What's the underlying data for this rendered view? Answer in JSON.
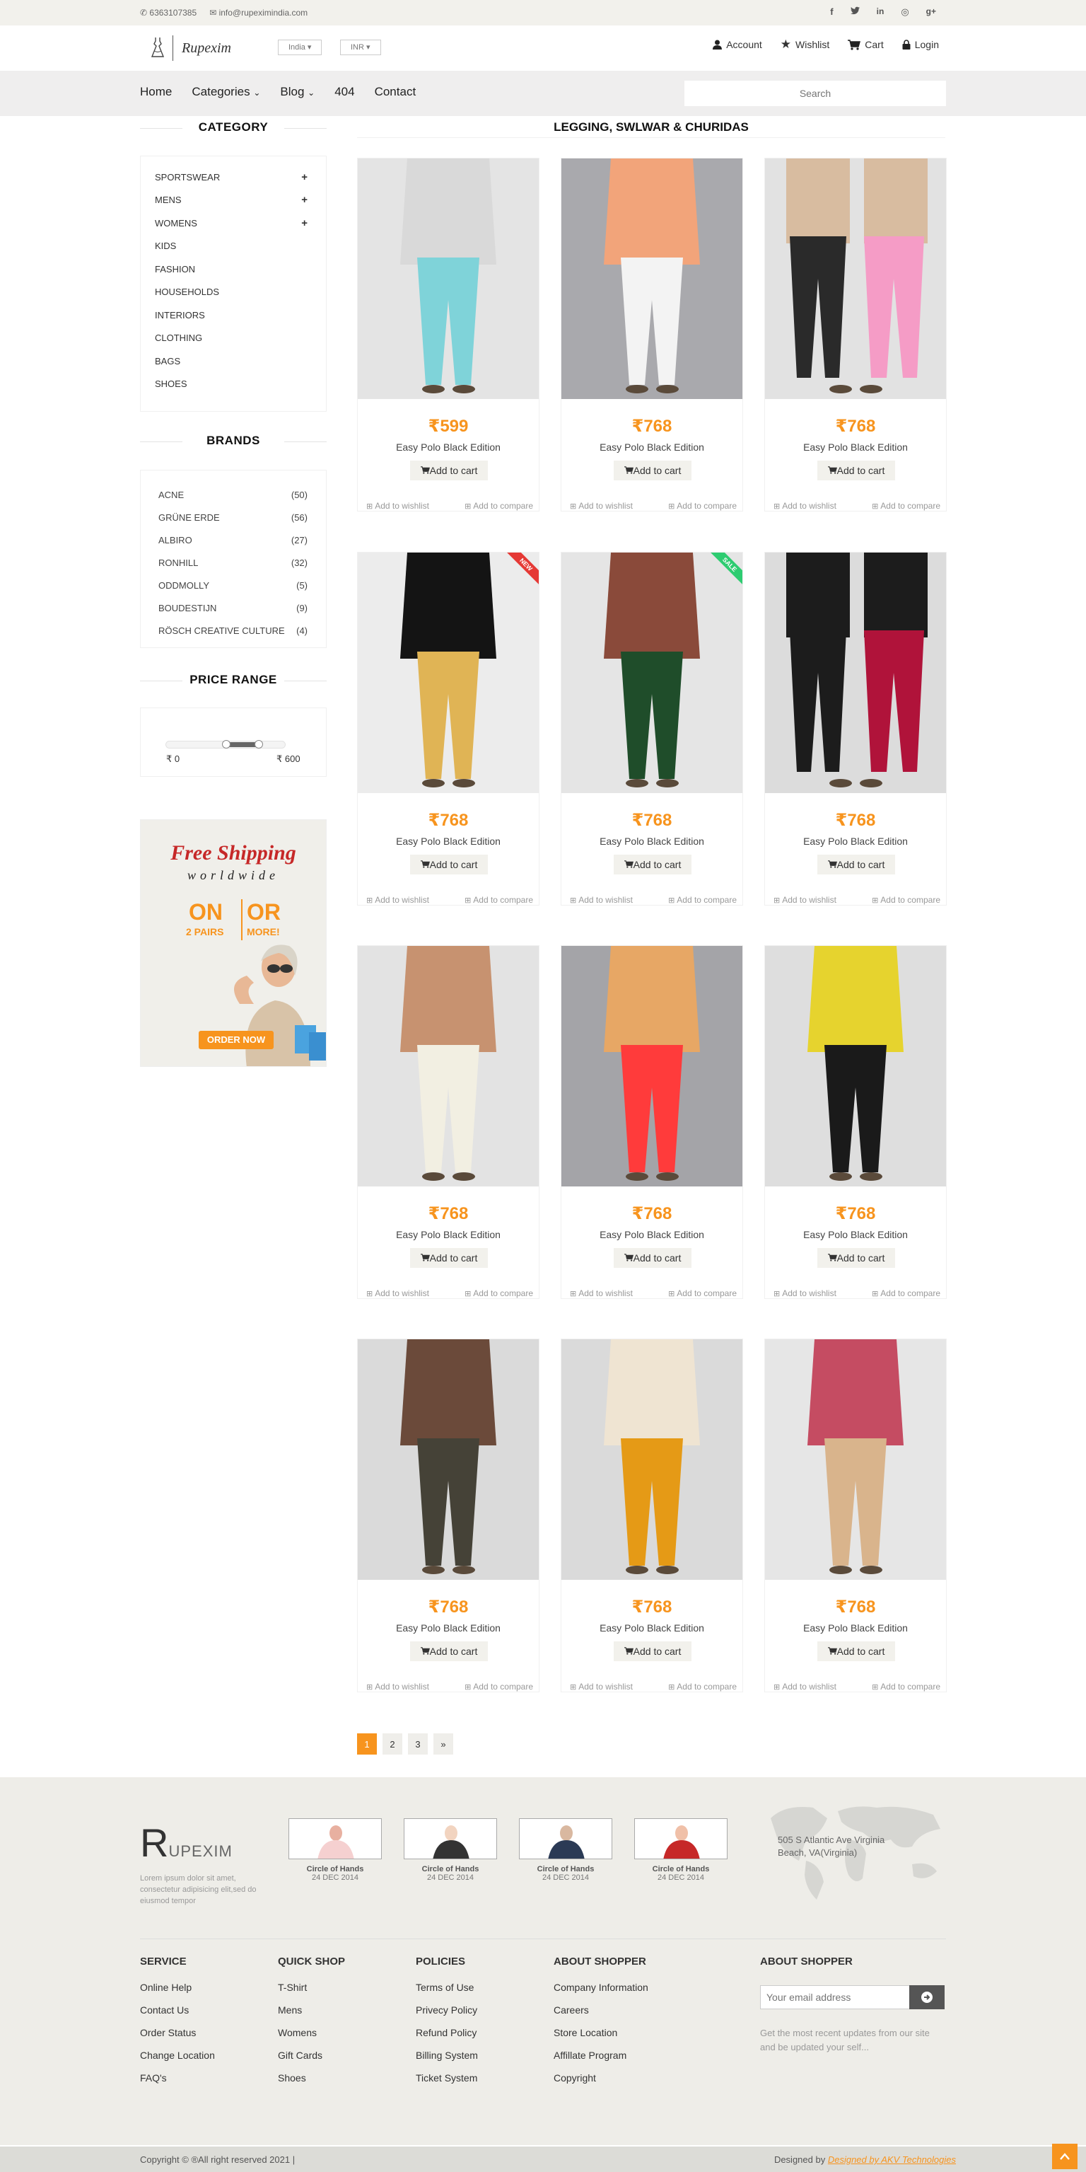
{
  "topbar": {
    "phone": "6363107385",
    "email": "info@rupeximindia.com",
    "social": [
      "facebook-icon",
      "twitter-icon",
      "linkedin-icon",
      "dribbble-icon",
      "google-plus-icon"
    ]
  },
  "header": {
    "brand": "Rupexim",
    "country": "India",
    "currency": "INR",
    "links": {
      "account": "Account",
      "wishlist": "Wishlist",
      "cart": "Cart",
      "login": "Login"
    }
  },
  "nav": {
    "home": "Home",
    "categories": "Categories",
    "blog": "Blog",
    "page404": "404",
    "contact": "Contact",
    "search_placeholder": "Search"
  },
  "sidebar": {
    "category_title": "CATEGORY",
    "categories": [
      {
        "label": "SPORTSWEAR",
        "expand": "+"
      },
      {
        "label": "MENS",
        "expand": "+"
      },
      {
        "label": "WOMENS",
        "expand": "+"
      },
      {
        "label": "KIDS",
        "expand": ""
      },
      {
        "label": "FASHION",
        "expand": ""
      },
      {
        "label": "HOUSEHOLDS",
        "expand": ""
      },
      {
        "label": "INTERIORS",
        "expand": ""
      },
      {
        "label": "CLOTHING",
        "expand": ""
      },
      {
        "label": "BAGS",
        "expand": ""
      },
      {
        "label": "SHOES",
        "expand": ""
      }
    ],
    "brands_title": "BRANDS",
    "brands": [
      {
        "label": "ACNE",
        "count": "(50)"
      },
      {
        "label": "GRÜNE ERDE",
        "count": "(56)"
      },
      {
        "label": "ALBIRO",
        "count": "(27)"
      },
      {
        "label": "RONHILL",
        "count": "(32)"
      },
      {
        "label": "ODDMOLLY",
        "count": "(5)"
      },
      {
        "label": "BOUDESTIJN",
        "count": "(9)"
      },
      {
        "label": "RÖSCH CREATIVE CULTURE",
        "count": "(4)"
      }
    ],
    "price_title": "PRICE RANGE",
    "price_min": "₹ 0",
    "price_max": "₹ 600",
    "price_range_selected": [
      0.5,
      0.77
    ],
    "promo": {
      "line1": "Free Shipping",
      "line2": "worldwide",
      "left_big": "ON",
      "left_small": "2 PAIRS",
      "right_big": "OR",
      "right_small": "MORE!",
      "cta": "ORDER NOW"
    }
  },
  "main": {
    "title": "LEGGING, SWLWAR & CHURIDAS",
    "actions": {
      "add_to_cart": "Add to cart",
      "wishlist": "Add to wishlist",
      "compare": "Add to compare"
    },
    "products": [
      {
        "price": "₹599",
        "name": "Easy Polo Black Edition",
        "top": "#d9d9d9",
        "bottom": "#7fd3d9",
        "bg": "#e4e4e4",
        "badge": ""
      },
      {
        "price": "₹768",
        "name": "Easy Polo Black Edition",
        "top": "#f2a47a",
        "bottom": "#f3f3f3",
        "bg": "#a9a9ad",
        "badge": ""
      },
      {
        "price": "₹768",
        "name": "Easy Polo Black Edition",
        "top": "#d8bca0",
        "bottom": "#2a2a2a",
        "bg": "#e2e2e2",
        "badge": "",
        "bottom2": "#f59cc6"
      },
      {
        "price": "₹768",
        "name": "Easy Polo Black Edition",
        "top": "#141414",
        "bottom": "#e0b455",
        "bg": "#ececec",
        "badge": "NEW",
        "badge_color": "#e53935"
      },
      {
        "price": "₹768",
        "name": "Easy Polo Black Edition",
        "top": "#8a4a3a",
        "bottom": "#1f4d2a",
        "bg": "#e5e5e5",
        "badge": "SALE",
        "badge_color": "#2ecc71"
      },
      {
        "price": "₹768",
        "name": "Easy Polo Black Edition",
        "top": "#1c1c1c",
        "bottom": "#1c1c1c",
        "bg": "#dcdcdc",
        "badge": "",
        "bottom2": "#b0133a"
      },
      {
        "price": "₹768",
        "name": "Easy Polo Black Edition",
        "top": "#c79270",
        "bottom": "#f2efe2",
        "bg": "#e3e3e3",
        "badge": ""
      },
      {
        "price": "₹768",
        "name": "Easy Polo Black Edition",
        "top": "#e7a765",
        "bottom": "#ff3b3b",
        "bg": "#a4a4a8",
        "badge": ""
      },
      {
        "price": "₹768",
        "name": "Easy Polo Black Edition",
        "top": "#e6d32e",
        "bottom": "#1a1a1a",
        "bg": "#dedede",
        "badge": ""
      },
      {
        "price": "₹768",
        "name": "Easy Polo Black Edition",
        "top": "#6b4a3a",
        "bottom": "#454237",
        "bg": "#dadada",
        "badge": ""
      },
      {
        "price": "₹768",
        "name": "Easy Polo Black Edition",
        "top": "#efe4d2",
        "bottom": "#e59a16",
        "bg": "#dadada",
        "badge": ""
      },
      {
        "price": "₹768",
        "name": "Easy Polo Black Edition",
        "top": "#c54c62",
        "bottom": "#d9b48c",
        "bg": "#e6e6e6",
        "badge": ""
      }
    ],
    "pages": [
      "1",
      "2",
      "3",
      "»"
    ],
    "active_page": "1"
  },
  "footer": {
    "logo_big": "R",
    "logo_rest": "UPEXIM",
    "description": "Lorem ipsum dolor sit amet, consectetur adipisicing elit,sed do eiusmod tempor",
    "posts": [
      {
        "title": "Circle of Hands",
        "date": "24 DEC 2014"
      },
      {
        "title": "Circle of Hands",
        "date": "24 DEC 2014"
      },
      {
        "title": "Circle of Hands",
        "date": "24 DEC 2014"
      },
      {
        "title": "Circle of Hands",
        "date": "24 DEC 2014"
      }
    ],
    "address": "505 S Atlantic Ave Virginia Beach, VA(Virginia)",
    "columns": [
      {
        "title": "SERVICE",
        "items": [
          "Online Help",
          "Contact Us",
          "Order Status",
          "Change Location",
          "FAQ's"
        ]
      },
      {
        "title": "QUICK SHOP",
        "items": [
          "T-Shirt",
          "Mens",
          "Womens",
          "Gift Cards",
          "Shoes"
        ]
      },
      {
        "title": "POLICIES",
        "items": [
          "Terms of Use",
          "Privecy Policy",
          "Refund Policy",
          "Billing System",
          "Ticket System"
        ]
      },
      {
        "title": "ABOUT SHOPPER",
        "items": [
          "Company Information",
          "Careers",
          "Store Location",
          "Affillate Program",
          "Copyright"
        ]
      },
      {
        "title": "ABOUT SHOPPER",
        "items": []
      }
    ],
    "email_placeholder": "Your email address",
    "subscribe_note": "Get the most recent updates from our site and be updated your self...",
    "copyright": "Copyright © ®All right reserved 2021 |",
    "designed_by": "Designed by",
    "designer": "Designed by AKV Technologies"
  },
  "colors": {
    "accent": "#f7941e",
    "topbar": "#f2f1ec",
    "footer": "#eeede8"
  }
}
